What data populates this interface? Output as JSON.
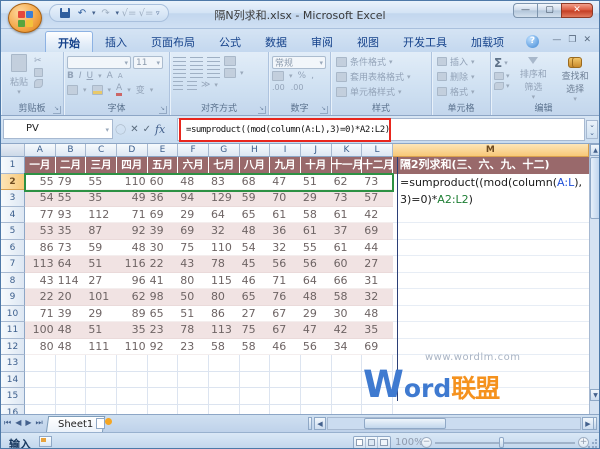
{
  "window": {
    "title": "隔N列求和.xlsx - Microsoft Excel"
  },
  "ribbon": {
    "tabs": [
      "开始",
      "插入",
      "页面布局",
      "公式",
      "数据",
      "审阅",
      "视图",
      "开发工具",
      "加载项"
    ],
    "active_tab": "开始",
    "groups": {
      "clipboard": {
        "label": "剪贴板",
        "paste": "粘贴"
      },
      "font": {
        "label": "字体",
        "size": "11",
        "bold": "B",
        "italic": "I",
        "underline": "U",
        "grow": "A",
        "shrink": "A",
        "color": "A",
        "phonetic": "变"
      },
      "alignment": {
        "label": "对齐方式"
      },
      "number": {
        "label": "数字",
        "format": "常规",
        "percent": "%",
        "comma": ",",
        "inc_dec": ".00",
        "dec_dec": ".00"
      },
      "styles": {
        "label": "样式",
        "items": [
          "条件格式",
          "套用表格格式",
          "单元格样式"
        ]
      },
      "cells": {
        "label": "单元格",
        "items": [
          "插入",
          "删除",
          "格式"
        ]
      },
      "editing": {
        "label": "编辑",
        "sum": "Σ",
        "sort": "排序和筛选",
        "find": "查找和选择"
      }
    }
  },
  "formula_bar": {
    "name_box": "PV",
    "cancel": "✕",
    "enter": "✓",
    "fx": "fx",
    "formula": "=sumproduct((mod(column(A:L),3)=0)*A2:L2)"
  },
  "sheet": {
    "column_letters": [
      "A",
      "B",
      "C",
      "D",
      "E",
      "F",
      "G",
      "H",
      "I",
      "J",
      "K",
      "L"
    ],
    "wide_column_letter": "M",
    "row_count": 16,
    "months": [
      "一月",
      "二月",
      "三月",
      "四月",
      "五月",
      "六月",
      "七月",
      "八月",
      "九月",
      "十月",
      "十一月",
      "十二月"
    ],
    "m1_label": "隔2列求和(三、六、九、十二)",
    "col_align": [
      "r",
      "l",
      "l",
      "r",
      "l",
      "l",
      "l",
      "l",
      "l",
      "l",
      "l",
      "l"
    ],
    "data": [
      [
        55,
        79,
        55,
        110,
        60,
        48,
        83,
        68,
        47,
        51,
        62,
        73
      ],
      [
        54,
        55,
        35,
        49,
        36,
        94,
        129,
        59,
        70,
        29,
        73,
        57
      ],
      [
        77,
        93,
        112,
        71,
        69,
        29,
        64,
        65,
        61,
        58,
        61,
        42
      ],
      [
        53,
        35,
        87,
        92,
        39,
        69,
        32,
        48,
        36,
        61,
        37,
        69
      ],
      [
        86,
        73,
        59,
        48,
        30,
        75,
        110,
        54,
        32,
        55,
        61,
        44
      ],
      [
        113,
        64,
        51,
        116,
        22,
        43,
        78,
        45,
        56,
        56,
        60,
        27
      ],
      [
        43,
        114,
        27,
        96,
        41,
        80,
        115,
        46,
        71,
        64,
        66,
        31
      ],
      [
        22,
        20,
        101,
        62,
        98,
        50,
        80,
        65,
        76,
        48,
        58,
        32
      ],
      [
        71,
        39,
        29,
        89,
        65,
        51,
        86,
        27,
        67,
        29,
        30,
        48
      ],
      [
        100,
        48,
        51,
        35,
        23,
        78,
        113,
        75,
        67,
        47,
        42,
        35
      ],
      [
        80,
        48,
        111,
        110,
        92,
        23,
        58,
        58,
        46,
        56,
        34,
        69
      ]
    ],
    "m2": {
      "p1": "=sumproduct((mod(column(",
      "ref1": "A:L",
      "p2": "),",
      "p3": "3)=0)*",
      "ref2": "A2:L2",
      "p4": ")"
    }
  },
  "watermark": {
    "url": "www.wordlm.com",
    "big_w": "W",
    "rest": "ord",
    "cn": "联盟"
  },
  "tabs_bar": {
    "sheet_name": "Sheet1"
  },
  "status_bar": {
    "mode": "输入",
    "zoom": "100%"
  }
}
